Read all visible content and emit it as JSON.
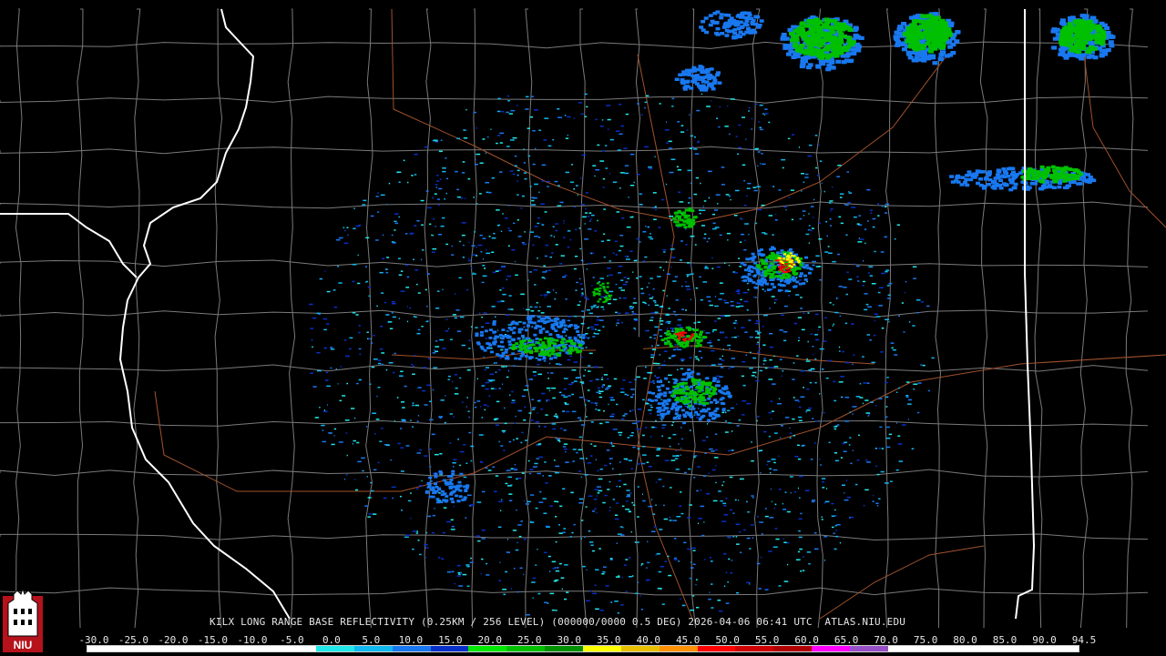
{
  "product": {
    "caption": "KILX LONG RANGE BASE REFLECTIVITY (0.25KM / 256 LEVEL) (000000/0000 0.5 DEG) 2026-04-06 06:41 UTC  ATLAS.NIU.EDU"
  },
  "legend": {
    "labels": [
      "-30.0",
      "-25.0",
      "-20.0",
      "-15.0",
      "-10.0",
      "-5.0",
      "0.0",
      "5.0",
      "10.0",
      "15.0",
      "20.0",
      "25.0",
      "30.0",
      "35.0",
      "40.0",
      "45.0",
      "50.0",
      "55.0",
      "60.0",
      "65.0",
      "70.0",
      "75.0",
      "80.0",
      "85.0",
      "90.0",
      "94.5"
    ],
    "colors": [
      "#ffffff",
      "#ffffff",
      "#ffffff",
      "#ffffff",
      "#ffffff",
      "#ffffff",
      "#20e8e8",
      "#10b8f0",
      "#1878f0",
      "#0830c8",
      "#00e800",
      "#00c000",
      "#009000",
      "#ffff00",
      "#e8c000",
      "#ff9000",
      "#ff0000",
      "#d00000",
      "#b00000",
      "#ff00ff",
      "#9850c8",
      "#ffffff",
      "#ffffff",
      "#ffffff",
      "#ffffff",
      "#ffffff"
    ]
  },
  "logo": {
    "text": "NIU"
  },
  "colors": {
    "background": "#000000",
    "county_lines": "#808080",
    "state_lines": "#ffffff",
    "roads": "#a0522d"
  },
  "radar_site": "KILX"
}
